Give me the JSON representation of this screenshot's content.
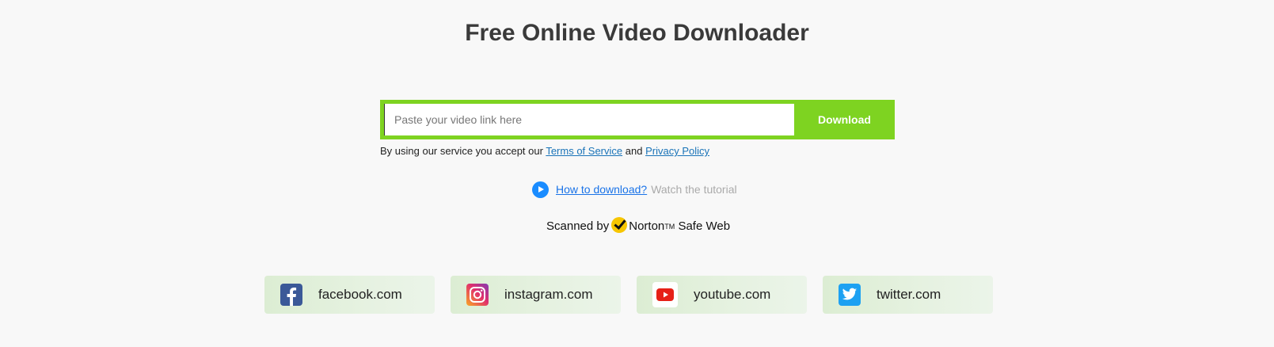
{
  "header": {
    "title": "Free Online Video Downloader"
  },
  "search": {
    "placeholder": "Paste your video link here",
    "value": "",
    "button_label": "Download"
  },
  "terms": {
    "prefix": "By using our service you accept our",
    "tos_label": "Terms of Service",
    "conjunction": "and",
    "privacy_label": "Privacy Policy"
  },
  "howto": {
    "icon": "play-icon",
    "link_label": "How to download?",
    "hint": "Watch the tutorial"
  },
  "norton": {
    "prefix": "Scanned by",
    "brand": "Norton",
    "tm": "TM",
    "suffix": "Safe Web"
  },
  "sites": [
    {
      "label": "facebook.com",
      "icon": "facebook-icon"
    },
    {
      "label": "instagram.com",
      "icon": "instagram-icon"
    },
    {
      "label": "youtube.com",
      "icon": "youtube-icon"
    },
    {
      "label": "twitter.com",
      "icon": "twitter-icon"
    }
  ],
  "colors": {
    "accent_green": "#7ed321",
    "link_blue": "#1a73e8",
    "background": "#f8f8f8"
  }
}
